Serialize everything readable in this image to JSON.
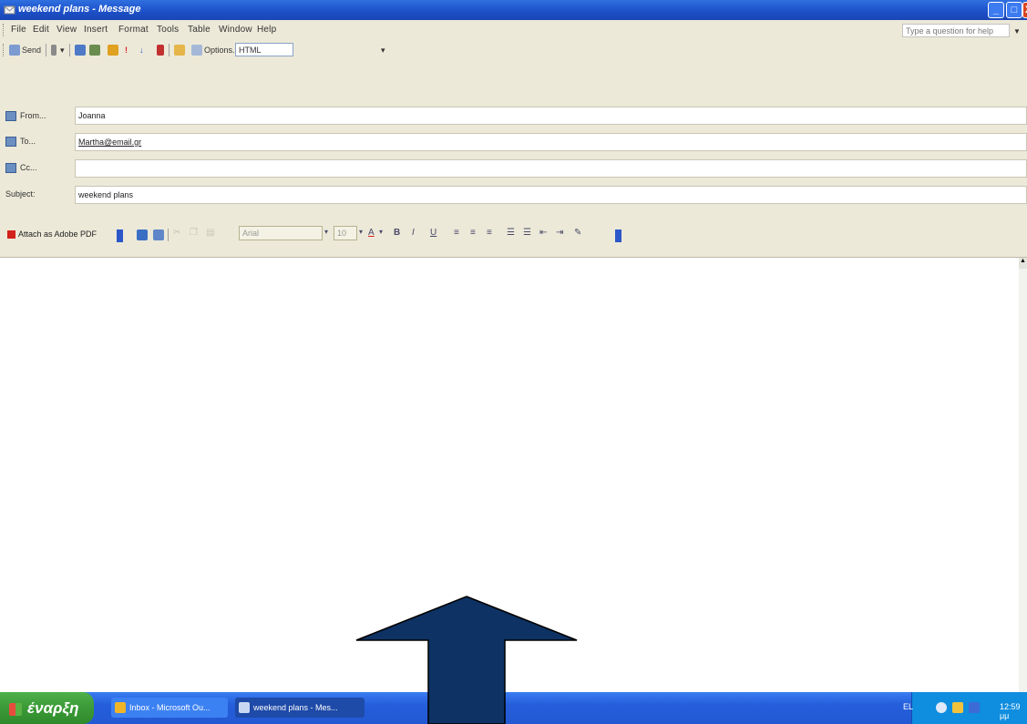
{
  "window": {
    "title": "weekend plans - Message",
    "min_glyph": "_",
    "max_glyph": "□",
    "close_glyph": "X"
  },
  "menu": {
    "items": [
      "File",
      "Edit",
      "View",
      "Insert",
      "Format",
      "Tools",
      "Table",
      "Window",
      "Help"
    ],
    "help_placeholder": "Type a question for help"
  },
  "toolbar": {
    "send_label": "Send",
    "options_label": "Options...",
    "format_value": "HTML"
  },
  "headers": {
    "from_label": "From...",
    "from_value": "Joanna",
    "to_label": "To...",
    "to_value": "Martha@email.gr",
    "cc_label": "Cc...",
    "cc_value": "",
    "subject_label": "Subject:",
    "subject_value": "weekend plans"
  },
  "format_toolbar": {
    "attach_label": "Attach as Adobe PDF",
    "font_value": "Arial",
    "size_value": "10",
    "bold": "B",
    "italic": "I",
    "underline": "U"
  },
  "taskbar": {
    "start_label": "έναρξη",
    "items": [
      "Inbox - Microsoft Ou...",
      "weekend plans - Mes..."
    ],
    "clock": "12:59 μμ",
    "lang": "EL"
  },
  "colors": {
    "titlebar": "#1c4fc7",
    "toolbar_bg": "#ece9d8",
    "taskbar": "#245edb",
    "start_green": "#3b9a37",
    "arrow_fill": "#0d3263"
  }
}
